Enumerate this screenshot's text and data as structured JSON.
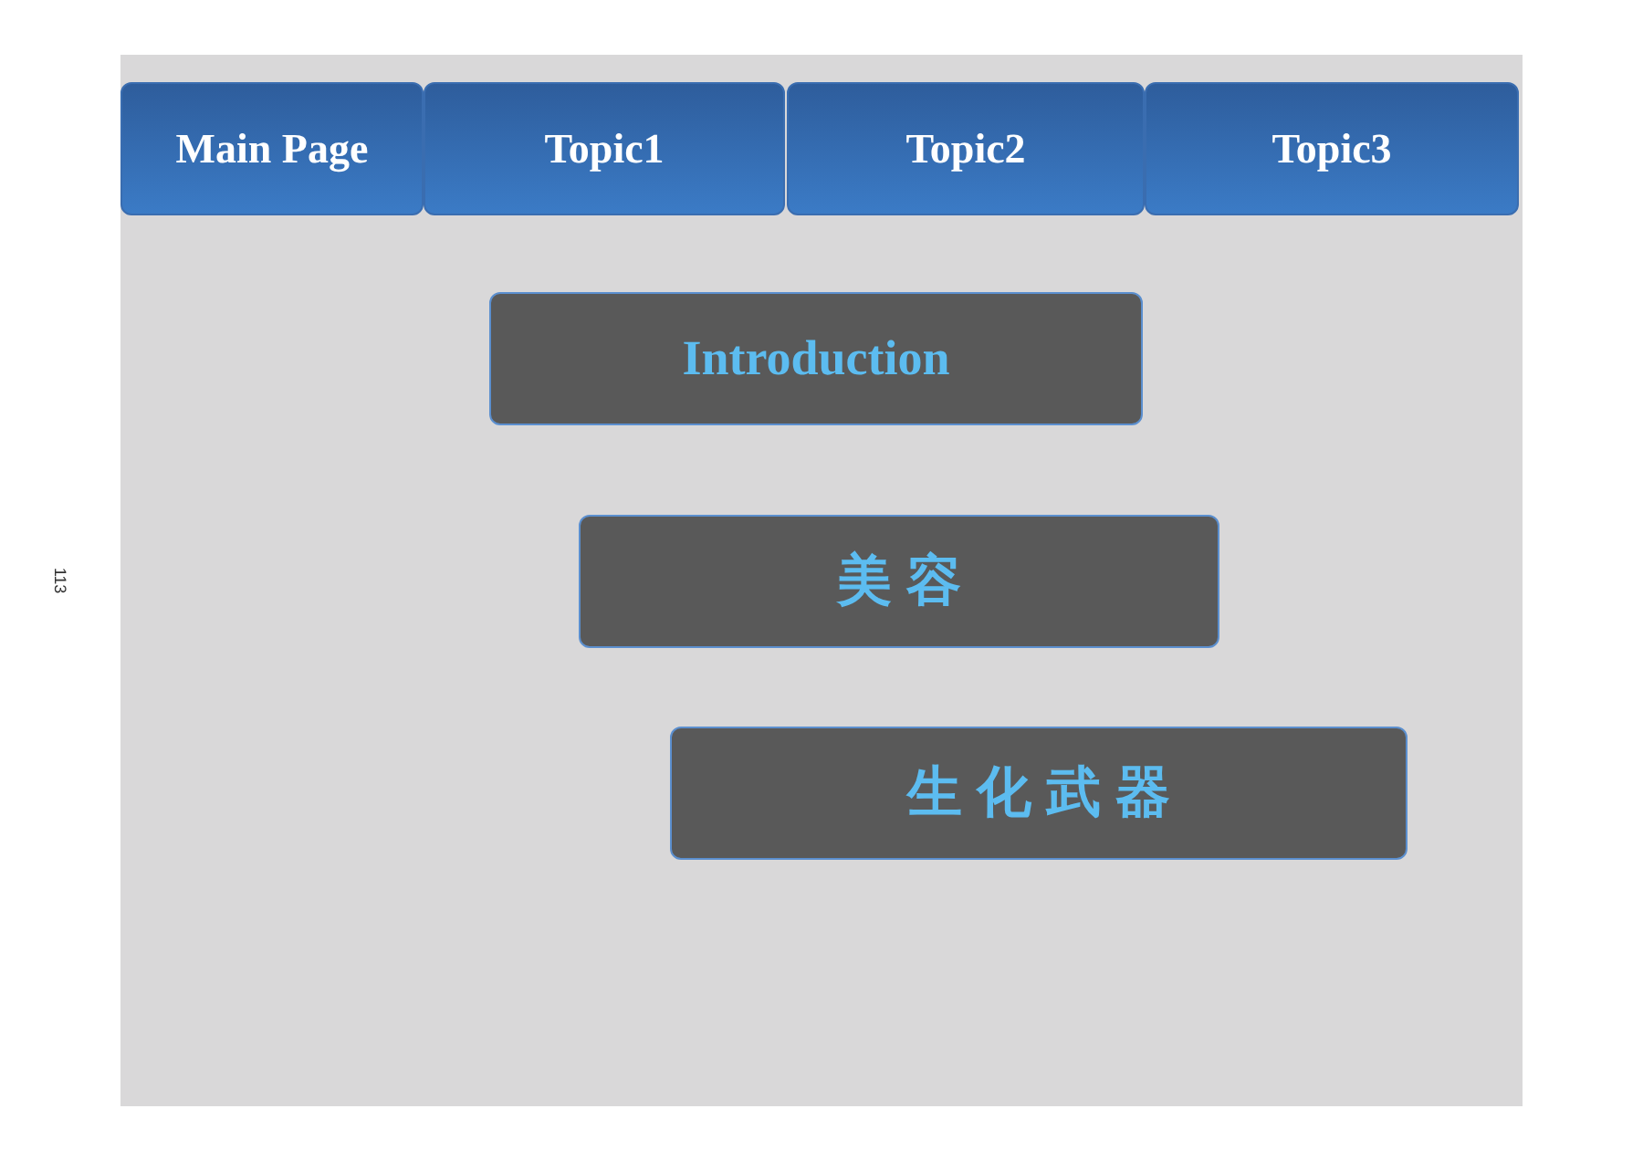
{
  "page_number": "113",
  "nav": [
    {
      "label": "Main Page"
    },
    {
      "label": "Topic1"
    },
    {
      "label": "Topic2"
    },
    {
      "label": "Topic3"
    }
  ],
  "menu_items": [
    {
      "label": "Introduction"
    },
    {
      "label": "美容"
    },
    {
      "label": "生化武器"
    }
  ]
}
